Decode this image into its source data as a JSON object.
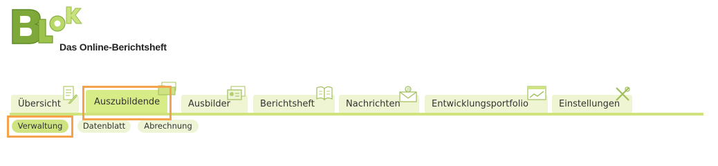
{
  "logo": {
    "letters": "BLok",
    "tagline": "Das Online-Berichtsheft",
    "colors": {
      "dark": "#7fa83a",
      "light": "#b8d96a",
      "text": "#222222"
    }
  },
  "tabs": [
    {
      "label": "Übersicht",
      "icon": "checklist-icon",
      "active": false
    },
    {
      "label": "Auszubildende",
      "icon": "folder-icon",
      "active": true
    },
    {
      "label": "Ausbilder",
      "icon": "id-card-icon",
      "active": false
    },
    {
      "label": "Berichtsheft",
      "icon": "book-icon",
      "active": false
    },
    {
      "label": "Nachrichten",
      "icon": "mail-icon",
      "active": false
    },
    {
      "label": "Entwicklungsportfolio",
      "icon": "chart-icon",
      "active": false
    },
    {
      "label": "Einstellungen",
      "icon": "tools-icon",
      "active": false
    }
  ],
  "subtabs": [
    {
      "label": "Verwaltung",
      "active": true
    },
    {
      "label": "Datenblatt",
      "active": false
    },
    {
      "label": "Abrechnung",
      "active": false
    }
  ],
  "colors": {
    "tab_bg": "#eff5d3",
    "tab_active_bg": "#d7eb86",
    "underline": "#cfe27b",
    "highlight": "#f5a24a"
  }
}
